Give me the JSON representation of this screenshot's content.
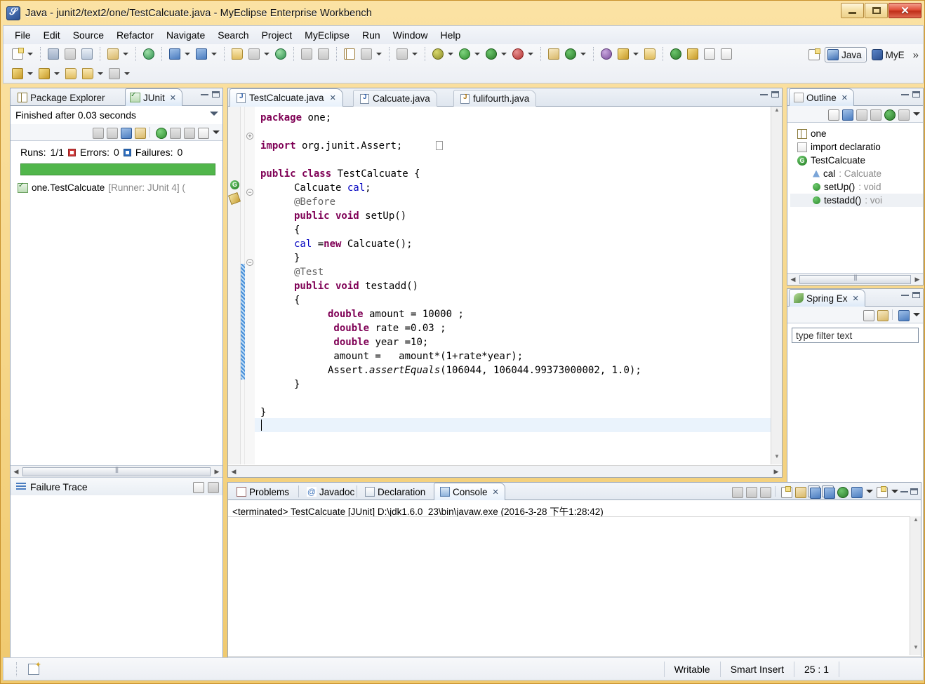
{
  "window": {
    "title": "Java - junit2/text2/one/TestCalcuate.java - MyEclipse Enterprise Workbench",
    "app_icon": "myeclipse-icon",
    "controls": {
      "minimize": "minimize-button",
      "maximize": "maximize-button",
      "close": "close-button"
    }
  },
  "menubar": {
    "items": [
      "File",
      "Edit",
      "Source",
      "Refactor",
      "Navigate",
      "Search",
      "Project",
      "MyEclipse",
      "Run",
      "Window",
      "Help"
    ]
  },
  "toolbar": {
    "row1_icons": [
      "new-wizard-icon",
      "new-dropdown",
      "save-icon",
      "save-all-icon",
      "print-icon",
      "myeclipse-wizard-icon",
      "myeclipse-dropdown",
      "java20-icon",
      "open-type-icon",
      "open-type-dropdown",
      "open-resource-icon",
      "open-resource-dropdown",
      "deploy-icon",
      "run-server-icon",
      "server-dropdown",
      "globe-icon",
      "export-icon",
      "import-icon",
      "db-browser-icon",
      "db-explorer-icon",
      "db-dropdown",
      "snapshot-icon",
      "snapshot-dropdown",
      "debug-icon",
      "debug-dropdown",
      "run-icon",
      "run-dropdown",
      "run-history-icon",
      "run-history-dropdown",
      "coverage-icon",
      "coverage-dropdown",
      "new-package-icon",
      "new-class-icon",
      "new-class-dropdown",
      "search-icon",
      "pin-icon",
      "pin-dropdown",
      "open-folder-icon",
      "next-annotation-icon",
      "toggle-markoccurrences-icon",
      "toggle-block-icon",
      "toggle-whitespace-icon"
    ],
    "row2_icons": [
      "prev-edit-icon",
      "prev-dropdown",
      "next-edit-icon",
      "next-dropdown",
      "back-icon",
      "forward-icon",
      "forward-dropdown",
      "next-nav-icon",
      "nav-dropdown"
    ],
    "perspectives": [
      {
        "label": "",
        "icon": "open-perspective-icon",
        "active": false
      },
      {
        "label": "Java",
        "icon": "java-perspective-icon",
        "active": true
      },
      {
        "label": "MyE",
        "icon": "myeclipse-perspective-icon",
        "active": false
      }
    ],
    "overflow": "»"
  },
  "junit_view": {
    "tabs": [
      {
        "label": "Package Explorer",
        "icon": "package-explorer-icon",
        "active": false,
        "closable": false
      },
      {
        "label": "JUnit",
        "icon": "junit-icon",
        "active": true,
        "closable": true
      }
    ],
    "status": "Finished after 0.03 seconds",
    "counts": {
      "runs_label": "Runs:",
      "runs_value": "1/1",
      "errors_label": "Errors:",
      "errors_value": "0",
      "failures_label": "Failures:",
      "failures_value": "0"
    },
    "progress_color": "#51b64b",
    "toolbar_icons": [
      "next-failure-icon",
      "prev-failure-icon",
      "show-failures-icon",
      "show-errors-icon",
      "rerun-test-icon",
      "rerun-failed-icon",
      "stop-icon",
      "test-history-icon",
      "view-menu-icon"
    ],
    "tree": [
      {
        "label": "one.TestCalcuate",
        "suffix": "[Runner: JUnit 4] (",
        "icon": "test-pass-icon"
      }
    ],
    "failure_trace_label": "Failure Trace",
    "failure_trace_icons": [
      "stack-filter-icon",
      "compare-result-icon"
    ]
  },
  "editor": {
    "tabs": [
      {
        "label": "TestCalcuate.java",
        "icon": "java-file-icon",
        "active": true,
        "closable": true
      },
      {
        "label": "Calcuate.java",
        "icon": "java-file-icon",
        "active": false,
        "closable": false
      },
      {
        "label": "fulifourth.java",
        "icon": "java-file-warning-icon",
        "active": false,
        "closable": false
      }
    ],
    "code_lines": [
      {
        "indent": 0,
        "tokens": [
          {
            "t": "package",
            "c": "kw"
          },
          {
            "t": " one;",
            "c": ""
          }
        ]
      },
      {
        "indent": 0,
        "tokens": []
      },
      {
        "indent": 0,
        "tokens": [
          {
            "t": "import",
            "c": "kw"
          },
          {
            "t": " org.junit.Assert;",
            "c": ""
          }
        ]
      },
      {
        "indent": 0,
        "tokens": []
      },
      {
        "indent": 0,
        "tokens": [
          {
            "t": "public class",
            "c": "kw"
          },
          {
            "t": " TestCalcuate {",
            "c": ""
          }
        ]
      },
      {
        "indent": 1,
        "tokens": [
          {
            "t": "Calcuate ",
            "c": ""
          },
          {
            "t": "cal",
            "c": "fld"
          },
          {
            "t": ";",
            "c": ""
          }
        ]
      },
      {
        "indent": 1,
        "tokens": [
          {
            "t": "@Before",
            "c": "ann"
          }
        ]
      },
      {
        "indent": 1,
        "tokens": [
          {
            "t": "public void",
            "c": "kw"
          },
          {
            "t": " setUp()",
            "c": ""
          }
        ]
      },
      {
        "indent": 1,
        "tokens": [
          {
            "t": "{",
            "c": ""
          }
        ]
      },
      {
        "indent": 1,
        "tokens": [
          {
            "t": "cal",
            "c": "fld"
          },
          {
            "t": " =",
            "c": ""
          },
          {
            "t": "new",
            "c": "kw"
          },
          {
            "t": " Calcuate();",
            "c": ""
          }
        ]
      },
      {
        "indent": 1,
        "tokens": [
          {
            "t": "}",
            "c": ""
          }
        ]
      },
      {
        "indent": 1,
        "tokens": [
          {
            "t": "@Test",
            "c": "ann"
          }
        ]
      },
      {
        "indent": 1,
        "tokens": [
          {
            "t": "public void",
            "c": "kw"
          },
          {
            "t": " testadd()",
            "c": ""
          }
        ]
      },
      {
        "indent": 1,
        "tokens": [
          {
            "t": "{",
            "c": ""
          }
        ]
      },
      {
        "indent": 2,
        "tokens": [
          {
            "t": "double",
            "c": "kw"
          },
          {
            "t": " amount = 10000 ;",
            "c": ""
          }
        ]
      },
      {
        "indent": 2,
        "tokens": [
          {
            "t": " double",
            "c": "kw"
          },
          {
            "t": " rate =0.03 ;",
            "c": ""
          }
        ]
      },
      {
        "indent": 2,
        "tokens": [
          {
            "t": " double",
            "c": "kw"
          },
          {
            "t": " year =10;",
            "c": ""
          }
        ]
      },
      {
        "indent": 2,
        "tokens": [
          {
            "t": " amount =   amount*(1+rate*year);",
            "c": ""
          }
        ]
      },
      {
        "indent": 2,
        "tokens": [
          {
            "t": "Assert.",
            "c": ""
          },
          {
            "t": "assertEquals",
            "c": "mth"
          },
          {
            "t": "(106044, 106044.99373000002, 1.0);",
            "c": ""
          }
        ]
      },
      {
        "indent": 1,
        "tokens": [
          {
            "t": "}",
            "c": ""
          }
        ]
      },
      {
        "indent": 0,
        "tokens": []
      },
      {
        "indent": 0,
        "tokens": [
          {
            "t": "}",
            "c": ""
          }
        ]
      }
    ],
    "markers": {
      "class_marker": "G",
      "edit_marker": "pencil-icon"
    }
  },
  "outline_view": {
    "tab": {
      "label": "Outline",
      "icon": "outline-icon",
      "closable": true
    },
    "toolbar_icons": [
      "collapse-all-icon",
      "sort-icon",
      "hide-fields-icon",
      "hide-static-icon",
      "hide-nonpublic-icon",
      "hide-local-icon",
      "view-menu-icon"
    ],
    "items": [
      {
        "label": "one",
        "type": "package",
        "indent": 0,
        "dim": "",
        "selected": false
      },
      {
        "label": "import declaratio",
        "type": "import",
        "indent": 0,
        "dim": "",
        "selected": false
      },
      {
        "label": "TestCalcuate",
        "type": "class",
        "indent": 0,
        "dim": "",
        "selected": false
      },
      {
        "label": "cal",
        "type": "field",
        "indent": 1,
        "dim": " : Calcuate",
        "selected": false
      },
      {
        "label": "setUp()",
        "type": "method",
        "indent": 1,
        "dim": " : void",
        "selected": false
      },
      {
        "label": "testadd()",
        "type": "method",
        "indent": 1,
        "dim": " : voi",
        "selected": true
      }
    ]
  },
  "spring_view": {
    "tab": {
      "label": "Spring Ex",
      "icon": "spring-leaf-icon",
      "closable": true
    },
    "toolbar_icons": [
      "collapse-all-icon",
      "link-editor-icon",
      "sort-icon",
      "view-menu-icon"
    ],
    "filter_placeholder": "type filter text"
  },
  "console_view": {
    "tabs": [
      {
        "label": "Problems",
        "icon": "problems-icon",
        "active": false
      },
      {
        "label": "Javadoc",
        "icon": "javadoc-icon",
        "active": false
      },
      {
        "label": "Declaration",
        "icon": "declaration-icon",
        "active": false
      },
      {
        "label": "Console",
        "icon": "console-icon",
        "active": true,
        "closable": true
      }
    ],
    "output": "<terminated> TestCalcuate [JUnit] D:\\jdk1.6.0_23\\bin\\javaw.exe (2016-3-28 下午1:28:42)",
    "toolbar_icons": [
      "terminate-icon",
      "remove-launch-icon",
      "remove-all-icon",
      "save-console-icon",
      "lock-scroll-icon",
      "show-console-icon",
      "clear-console-icon",
      "pin-console-icon",
      "display-console-icon",
      "display-dropdown",
      "open-console-icon",
      "open-dropdown"
    ]
  },
  "statusbar": {
    "icon": "writable-icon",
    "cells": [
      "Writable",
      "Smart Insert",
      "25 : 1"
    ]
  }
}
